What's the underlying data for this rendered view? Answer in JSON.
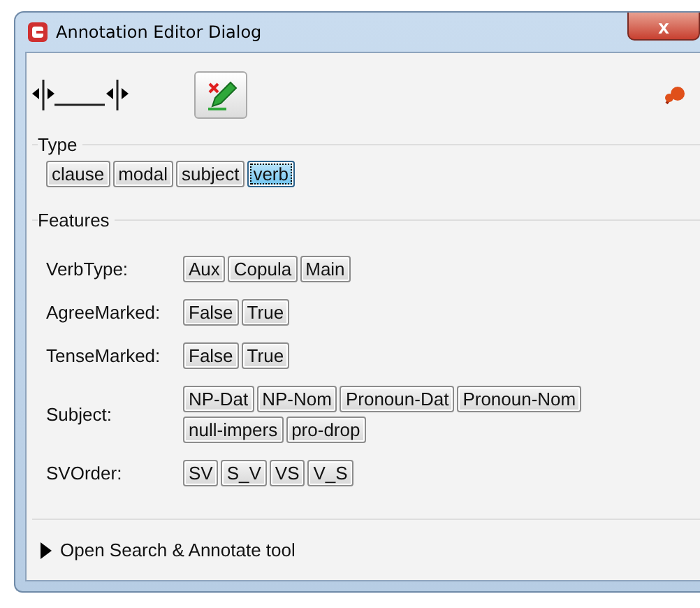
{
  "window": {
    "title": "Annotation Editor Dialog",
    "close": "x"
  },
  "type": {
    "label": "Type",
    "options": [
      {
        "label": "clause",
        "selected": false
      },
      {
        "label": "modal",
        "selected": false
      },
      {
        "label": "subject",
        "selected": false
      },
      {
        "label": "verb",
        "selected": true
      }
    ]
  },
  "features": {
    "label": "Features",
    "rows": [
      {
        "name": "VerbType:",
        "options": [
          {
            "label": "Aux",
            "selected": false
          },
          {
            "label": "Copula",
            "selected": false
          },
          {
            "label": "Main",
            "selected": false
          }
        ]
      },
      {
        "name": "AgreeMarked:",
        "options": [
          {
            "label": "False",
            "selected": false
          },
          {
            "label": "True",
            "selected": false
          }
        ]
      },
      {
        "name": "TenseMarked:",
        "options": [
          {
            "label": "False",
            "selected": false
          },
          {
            "label": "True",
            "selected": false
          }
        ]
      },
      {
        "name": "Subject:",
        "options": [
          {
            "label": "NP-Dat",
            "selected": false
          },
          {
            "label": "NP-Nom",
            "selected": false
          },
          {
            "label": "Pronoun-Dat",
            "selected": false
          },
          {
            "label": "Pronoun-Nom",
            "selected": false
          },
          {
            "label": "null-impers",
            "selected": false
          },
          {
            "label": "pro-drop",
            "selected": false
          }
        ]
      },
      {
        "name": "SVOrder:",
        "options": [
          {
            "label": "SV",
            "selected": false
          },
          {
            "label": "S_V",
            "selected": false
          },
          {
            "label": "VS",
            "selected": false
          },
          {
            "label": "V_S",
            "selected": false
          }
        ]
      }
    ]
  },
  "footer": {
    "label": "Open Search & Annotate tool",
    "expanded": false
  }
}
